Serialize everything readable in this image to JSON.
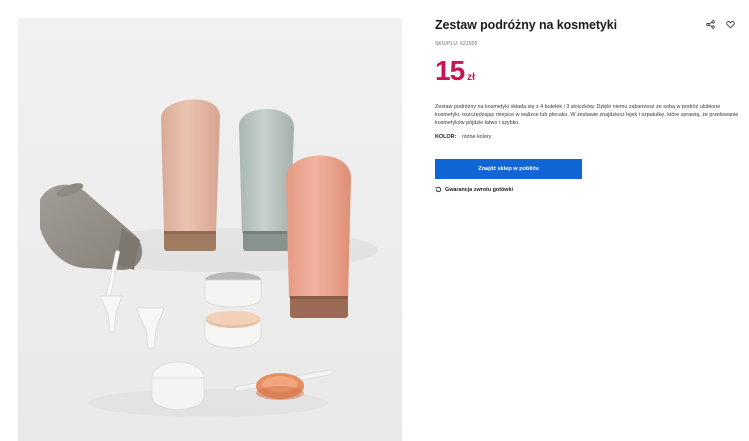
{
  "product": {
    "title": "Zestaw podróżny na kosmetyki",
    "sku": "SKU/PLU: 621505",
    "price": "15",
    "currency": "zł",
    "description": "Zestaw podróżny na kosmetyki składa się z 4 butelek i 3 słoiczków. Dzięki niemu zabierzesz ze sobą w podróż ulubione kosmetyki, oszczędzając miejsce w walizce lub plecaku. W zestawie znajdziesz lejek i szpatułkę, które sprawią, że przelewanie kosmetyków pójdzie łatwo i szybko.",
    "color_label": "KOLOR:",
    "color_value": "różne kolory",
    "store_button": "Znajdź sklep w pobliżu",
    "guarantee": "Gwarancja zwrotu gotówki"
  },
  "icons": {
    "share": "share-icon",
    "favorite": "heart-icon",
    "refresh": "refresh-icon"
  },
  "colors": {
    "price": "#c8145a",
    "button": "#1066d5",
    "image_bg": "#efefef"
  }
}
